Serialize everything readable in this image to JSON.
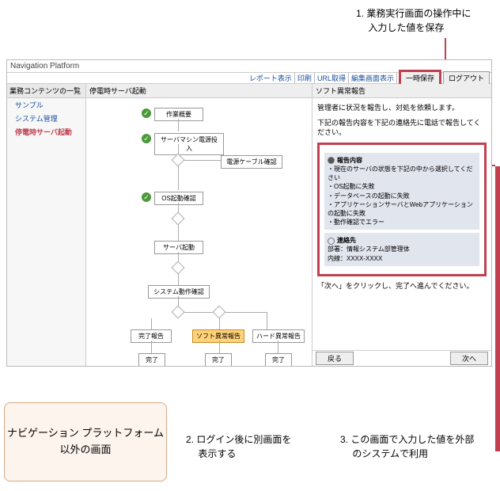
{
  "callouts": {
    "c1": "1. 業務実行画面の操作中に\n　 入力した値を保存",
    "c2": "2. ログイン後に別画面を\n　 表示する",
    "c3": "3. この画面で入力した値を外部\n　 のシステムで利用"
  },
  "extbox": "ナビゲーション プラットフォーム以外の画面",
  "app": {
    "title": "Navigation Platform"
  },
  "menu": {
    "report": "レポート表示",
    "print": "印刷",
    "url": "URL取得",
    "edit": "編集画面表示",
    "save": "一時保存",
    "logout": "ログアウト"
  },
  "sidebar": {
    "header": "業務コンテンツの一覧",
    "items": [
      "サンプル",
      "システム管理",
      "停電時サーバ起動"
    ]
  },
  "flow": {
    "header": "停電時サーバ起動",
    "nodes": {
      "n1": "作業概要",
      "n2": "サーバマシン電源投入",
      "n3": "電源ケーブル確認",
      "n4": "OS起動確認",
      "n5": "サーバ起動",
      "n6": "システム動作確認",
      "n7": "完了報告",
      "n8": "ソフト異常報告",
      "n9": "ハード異常報告",
      "e1": "完了",
      "e2": "完了",
      "e3": "完了"
    }
  },
  "right": {
    "header": "ソフト異常報告",
    "lead1": "管理者に状況を報告し、対処を依頼します。",
    "lead2": "下記の報告内容を下記の連絡先に電話で報告してください。",
    "g1": {
      "title": "報告内容",
      "l1": "・現在のサーバの状態を下記の中から選択してください",
      "l2": "・OS起動に失敗",
      "l3": "・データベースの起動に失敗",
      "l4": "・アプリケーションサーバとWebアプリケーションの起動に失敗",
      "l5": "・動作確認でエラー"
    },
    "g2": {
      "title": "連絡先",
      "l1": "部署：情報システム部管理体",
      "l2": "内線：XXXX-XXXX"
    },
    "next": "「次へ」をクリックし、完了へ進んでください。",
    "back": "戻る",
    "fwd": "次へ"
  }
}
